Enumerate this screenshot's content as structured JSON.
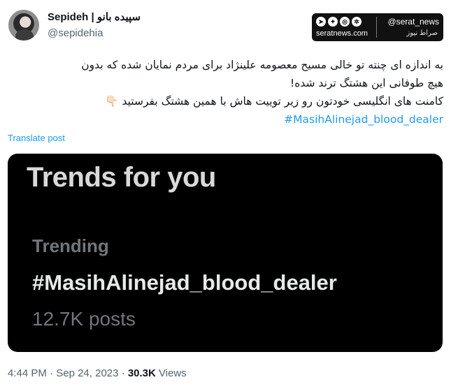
{
  "author": {
    "name": "Sepideh | سپیده بانو",
    "handle": "@sepidehia"
  },
  "watermark": {
    "handle": "@serat_news",
    "site": "seratnews.com",
    "logo": "صراط نیوز",
    "icons": [
      "telegram-icon",
      "twitter-icon",
      "instagram-icon",
      "aparat-icon"
    ]
  },
  "tweet": {
    "line1": "به اندازه ای چنته تو خالی مسیح معصومه علینژاد برای مردم نمایان شده که بدون",
    "line2": "هیچ طوفانی این هشتگ ترند شده!",
    "line3": "کامنت های انگلیسی خودتون رو زیر توییت هاش با همین هشتگ بفرستید",
    "hand_emoji": "👇🏻",
    "hashtag": "#MasihAlinejad_blood_dealer"
  },
  "translate_label": "Translate post",
  "media": {
    "title": "Trends for you",
    "label": "Trending",
    "hashtag": "#MasihAlinejad_blood_dealer",
    "posts": "12.7K posts"
  },
  "meta": {
    "time": "4:44 PM",
    "separator1": " · ",
    "date": "Sep 24, 2023",
    "separator2": " · ",
    "views_count": "30.3K",
    "views_label": " Views"
  },
  "colors": {
    "link": "#1d9bf0",
    "secondary_text": "#536471",
    "media_bg": "#000000"
  }
}
